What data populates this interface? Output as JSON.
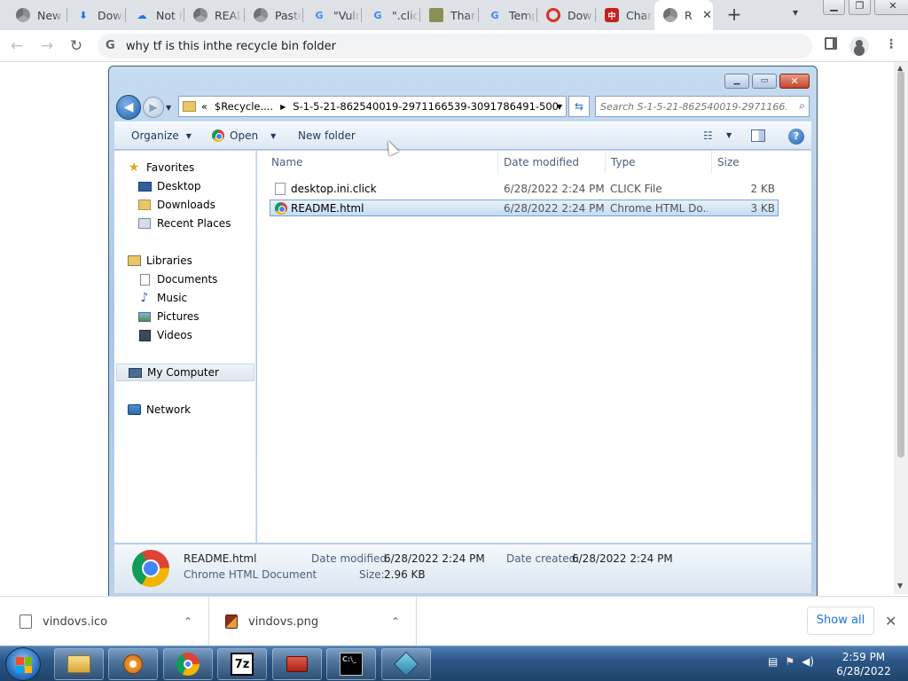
{
  "browser": {
    "tabs": [
      {
        "label": "New",
        "icon": "chrome-icon",
        "color": "#5f6368"
      },
      {
        "label": "Down",
        "icon": "download-icon",
        "color": "#1a73e8"
      },
      {
        "label": "Not F",
        "icon": "cloud-upload-icon",
        "color": "#1a73e8"
      },
      {
        "label": "READ",
        "icon": "chrome-icon",
        "color": "#5f6368"
      },
      {
        "label": "Paste",
        "icon": "chrome-icon",
        "color": "#5f6368"
      },
      {
        "label": "\"Vuln",
        "icon": "google-icon",
        "color": "#4285f4"
      },
      {
        "label": "\".click",
        "icon": "google-icon",
        "color": "#4285f4"
      },
      {
        "label": "Than",
        "icon": "face-icon",
        "color": "#6b7a3a"
      },
      {
        "label": "Temp",
        "icon": "google-icon",
        "color": "#4285f4"
      },
      {
        "label": "Dow",
        "icon": "opera-icon",
        "color": "#d93025"
      },
      {
        "label": "Char",
        "icon": "charmap-icon",
        "color": "#c5221f"
      },
      {
        "label": "R",
        "icon": "chrome-icon",
        "color": "#5f6368"
      }
    ],
    "new_tab_label": "+",
    "omnibox": {
      "value": "why tf is this inthe recycle bin folder"
    }
  },
  "explorer": {
    "address": {
      "prefix": "«",
      "segments": [
        "$Recycle....",
        "S-1-5-21-862540019-2971166539-3091786491-500"
      ]
    },
    "search": {
      "placeholder": "Search S-1-5-21-862540019-29711665..."
    },
    "toolbar": {
      "organize": "Organize",
      "open": "Open",
      "new_folder": "New folder"
    },
    "nav": {
      "favorites": "Favorites",
      "desktop": "Desktop",
      "downloads": "Downloads",
      "recent": "Recent Places",
      "libraries": "Libraries",
      "documents": "Documents",
      "music": "Music",
      "pictures": "Pictures",
      "videos": "Videos",
      "computer": "My Computer",
      "network": "Network"
    },
    "columns": {
      "name": "Name",
      "date": "Date modified",
      "type": "Type",
      "size": "Size"
    },
    "files": [
      {
        "name": "desktop.ini.click",
        "date": "6/28/2022 2:24 PM",
        "type": "CLICK File",
        "size": "2 KB"
      },
      {
        "name": "README.html",
        "date": "6/28/2022 2:24 PM",
        "type": "Chrome HTML Do...",
        "size": "3 KB"
      }
    ],
    "details": {
      "name": "README.html",
      "kind": "Chrome HTML Document",
      "modified_label": "Date modified:",
      "modified_value": "6/28/2022 2:24 PM",
      "size_label": "Size:",
      "size_value": "2.96 KB",
      "created_label": "Date created:",
      "created_value": "6/28/2022 2:24 PM"
    }
  },
  "downloads": {
    "items": [
      {
        "name": "vindovs.ico"
      },
      {
        "name": "vindovs.png"
      }
    ],
    "show_all": "Show all"
  },
  "taskbar": {
    "time": "2:59 PM",
    "date": "6/28/2022",
    "apps": [
      "explorer-icon",
      "media-player-icon",
      "chrome-icon",
      "7zip-icon",
      "toolbox-icon",
      "cmd-icon",
      "cubes-icon"
    ]
  }
}
